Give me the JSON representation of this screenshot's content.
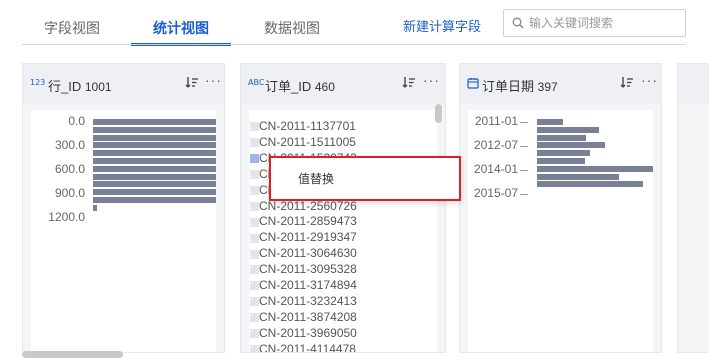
{
  "tabs": [
    {
      "label": "字段视图",
      "active": false
    },
    {
      "label": "统计视图",
      "active": true
    },
    {
      "label": "数据视图",
      "active": false
    }
  ],
  "toolbar": {
    "new_calc_label": "新建计算字段",
    "search_placeholder": "输入关键词搜索"
  },
  "cards": [
    {
      "type_badge": "123",
      "title": "行_ID",
      "count": "1001",
      "axis_labels": [
        "0.0",
        "300.0",
        "600.0",
        "900.0",
        "1200.0"
      ],
      "histogram_values": [
        1,
        1,
        1,
        1,
        1,
        1,
        1,
        1,
        1,
        1,
        1,
        0.03
      ]
    },
    {
      "type_badge": "ABC",
      "title": "订单_ID",
      "count": "460",
      "items": [
        "CN-2011-1137701",
        "CN-2011-1511005",
        "CN-2011-1520743",
        "CN-2011-1527391",
        "CN-2011-2081654",
        "CN-2011-2560726",
        "CN-2011-2859473",
        "CN-2011-2919347",
        "CN-2011-3064630",
        "CN-2011-3095328",
        "CN-2011-3174894",
        "CN-2011-3232413",
        "CN-2011-3874208",
        "CN-2011-3969050",
        "CN-2011-4114478"
      ],
      "selected_index": 2
    },
    {
      "type_badge": "calendar",
      "title": "订单日期",
      "count": "397",
      "axis_labels": [
        "2011-01",
        "2012-07",
        "2014-01",
        "2015-07"
      ],
      "histogram_values": [
        0.22,
        0.53,
        0.42,
        0.58,
        0.45,
        0.41,
        1.0,
        0.7,
        0.91
      ]
    }
  ],
  "context_menu": {
    "items": [
      "值替换"
    ]
  },
  "colors": {
    "accent": "#1b5fd1",
    "bar": "#7a8196",
    "highlight_border": "#e02020"
  }
}
